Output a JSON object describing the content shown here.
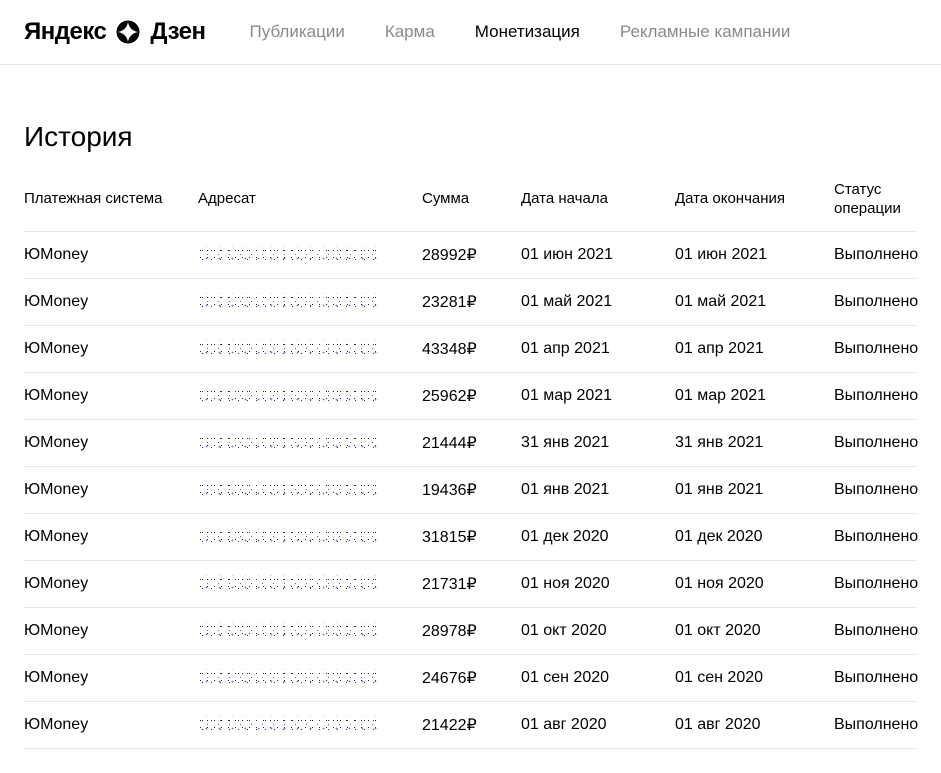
{
  "header": {
    "logo_yandex": "Яндекс",
    "logo_dzen": "Дзен",
    "nav": [
      {
        "label": "Публикации",
        "active": false
      },
      {
        "label": "Карма",
        "active": false
      },
      {
        "label": "Монетизация",
        "active": true
      },
      {
        "label": "Рекламные кампании",
        "active": false
      }
    ]
  },
  "page": {
    "title": "История"
  },
  "table": {
    "columns": {
      "system": "Платежная система",
      "recipient": "Адресат",
      "amount": "Сумма",
      "start": "Дата начала",
      "end": "Дата окончания",
      "status": "Статус операции"
    },
    "currency": "₽",
    "rows": [
      {
        "system": "ЮMoney",
        "amount": "28992",
        "start": "01 июн 2021",
        "end": "01 июн 2021",
        "status": "Выполнено"
      },
      {
        "system": "ЮMoney",
        "amount": "23281",
        "start": "01 май 2021",
        "end": "01 май 2021",
        "status": "Выполнено"
      },
      {
        "system": "ЮMoney",
        "amount": "43348",
        "start": "01 апр 2021",
        "end": "01 апр 2021",
        "status": "Выполнено"
      },
      {
        "system": "ЮMoney",
        "amount": "25962",
        "start": "01 мар 2021",
        "end": "01 мар 2021",
        "status": "Выполнено"
      },
      {
        "system": "ЮMoney",
        "amount": "21444",
        "start": "31 янв 2021",
        "end": "31 янв 2021",
        "status": "Выполнено"
      },
      {
        "system": "ЮMoney",
        "amount": "19436",
        "start": "01 янв 2021",
        "end": "01 янв 2021",
        "status": "Выполнено"
      },
      {
        "system": "ЮMoney",
        "amount": "31815",
        "start": "01 дек 2020",
        "end": "01 дек 2020",
        "status": "Выполнено"
      },
      {
        "system": "ЮMoney",
        "amount": "21731",
        "start": "01 ноя 2020",
        "end": "01 ноя 2020",
        "status": "Выполнено"
      },
      {
        "system": "ЮMoney",
        "amount": "28978",
        "start": "01 окт 2020",
        "end": "01 окт 2020",
        "status": "Выполнено"
      },
      {
        "system": "ЮMoney",
        "amount": "24676",
        "start": "01 сен 2020",
        "end": "01 сен 2020",
        "status": "Выполнено"
      },
      {
        "system": "ЮMoney",
        "amount": "21422",
        "start": "01 авг 2020",
        "end": "01 авг 2020",
        "status": "Выполнено"
      }
    ]
  }
}
